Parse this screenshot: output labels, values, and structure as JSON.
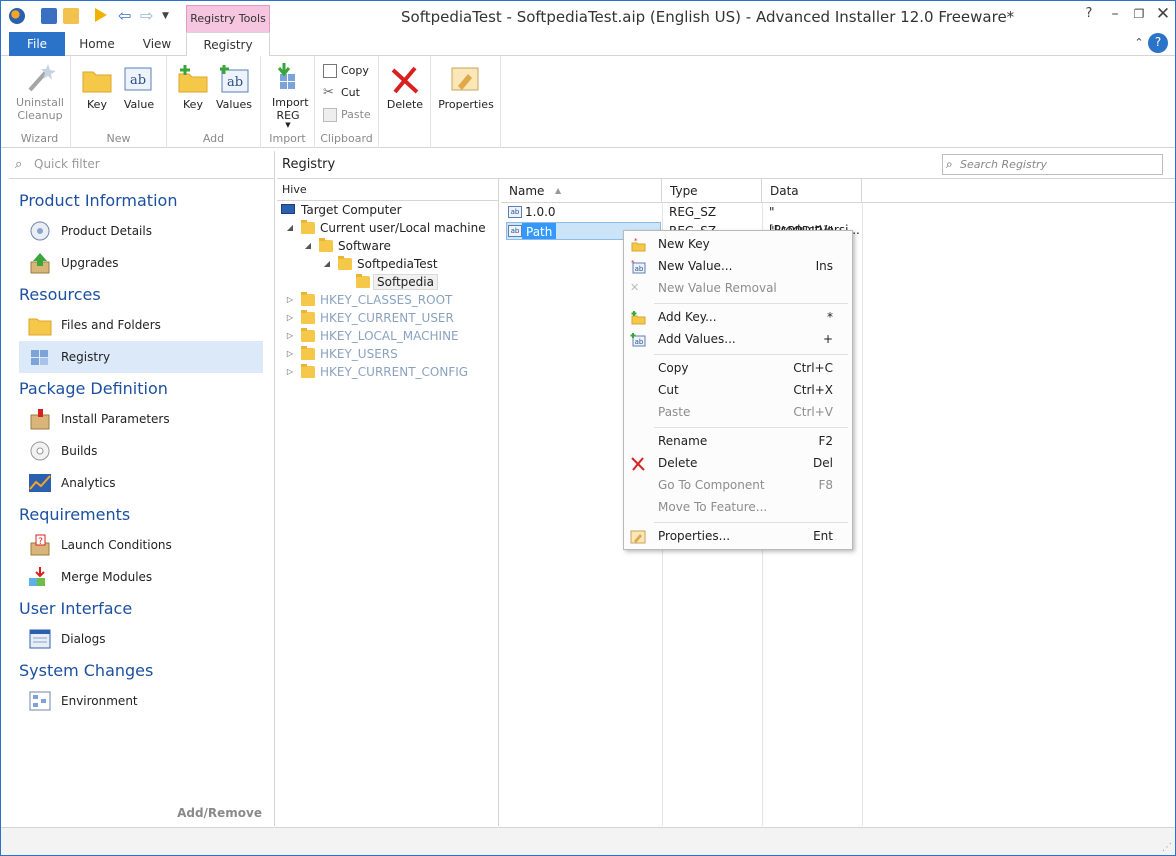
{
  "window": {
    "title": "SoftpediaTest - SoftpediaTest.aip (English US) - Advanced Installer 12.0 Freeware*",
    "context_tab_group": "Registry Tools"
  },
  "ribbon": {
    "tabs": [
      "File",
      "Home",
      "View",
      "Registry"
    ],
    "groups": {
      "wizard": {
        "label": "Wizard",
        "uninstall": "Uninstall Cleanup"
      },
      "new": {
        "label": "New",
        "key": "Key",
        "value": "Value"
      },
      "add": {
        "label": "Add",
        "key": "Key",
        "values": "Values"
      },
      "import": {
        "label": "Import",
        "import_reg": "Import REG"
      },
      "clipboard": {
        "label": "Clipboard",
        "copy": "Copy",
        "cut": "Cut",
        "paste": "Paste"
      },
      "delete": "Delete",
      "properties": "Properties"
    }
  },
  "left": {
    "quick_filter_placeholder": "Quick filter",
    "sections": [
      {
        "title": "Product Information",
        "items": [
          "Product Details",
          "Upgrades"
        ]
      },
      {
        "title": "Resources",
        "items": [
          "Files and Folders",
          "Registry"
        ]
      },
      {
        "title": "Package Definition",
        "items": [
          "Install Parameters",
          "Builds",
          "Analytics"
        ]
      },
      {
        "title": "Requirements",
        "items": [
          "Launch Conditions",
          "Merge Modules"
        ]
      },
      {
        "title": "User Interface",
        "items": [
          "Dialogs"
        ]
      },
      {
        "title": "System Changes",
        "items": [
          "Environment"
        ]
      }
    ],
    "selected_item": "Registry",
    "add_remove": "Add/Remove"
  },
  "page": {
    "title": "Registry",
    "search_placeholder": "Search Registry"
  },
  "hive": {
    "header": "Hive",
    "nodes": [
      {
        "label": "Target Computer"
      },
      {
        "label": "Current user/Local machine"
      },
      {
        "label": "Software"
      },
      {
        "label": "SoftpediaTest"
      },
      {
        "label": "Softpedia"
      },
      {
        "label": "HKEY_CLASSES_ROOT"
      },
      {
        "label": "HKEY_CURRENT_USER"
      },
      {
        "label": "HKEY_LOCAL_MACHINE"
      },
      {
        "label": "HKEY_USERS"
      },
      {
        "label": "HKEY_CURRENT_CONFIG"
      }
    ]
  },
  "grid": {
    "columns": [
      "Name",
      "Type",
      "Data"
    ],
    "rows": [
      {
        "name": "1.0.0",
        "type": "REG_SZ",
        "data": "\"[ProductVersi..."
      },
      {
        "name": "Path",
        "type": "REG_SZ",
        "data": "\"[APPDIR]\""
      }
    ]
  },
  "context_menu": {
    "items": [
      {
        "label": "New Key",
        "key": "",
        "enabled": true,
        "icon": "new-key-icon"
      },
      {
        "label": "New Value...",
        "key": "Ins",
        "enabled": true,
        "icon": "new-value-icon"
      },
      {
        "label": "New Value Removal",
        "key": "",
        "enabled": false,
        "icon": "new-value-removal-icon"
      },
      {
        "label": "Add Key...",
        "key": "*",
        "enabled": true,
        "icon": "add-key-icon"
      },
      {
        "label": "Add Values...",
        "key": "+",
        "enabled": true,
        "icon": "add-values-icon"
      },
      {
        "label": "Copy",
        "key": "Ctrl+C",
        "enabled": true
      },
      {
        "label": "Cut",
        "key": "Ctrl+X",
        "enabled": true
      },
      {
        "label": "Paste",
        "key": "Ctrl+V",
        "enabled": false
      },
      {
        "label": "Rename",
        "key": "F2",
        "enabled": true
      },
      {
        "label": "Delete",
        "key": "Del",
        "enabled": true,
        "icon": "delete-icon"
      },
      {
        "label": "Go To Component",
        "key": "F8",
        "enabled": false
      },
      {
        "label": "Move To Feature...",
        "key": "",
        "enabled": false
      },
      {
        "label": "Properties...",
        "key": "Ent",
        "enabled": true,
        "icon": "properties-icon"
      }
    ]
  },
  "colors": {
    "accent": "#2b73c8",
    "section_title": "#1c50a0",
    "context_tab": "#f6c6e0",
    "selection": "#cce4f7"
  }
}
